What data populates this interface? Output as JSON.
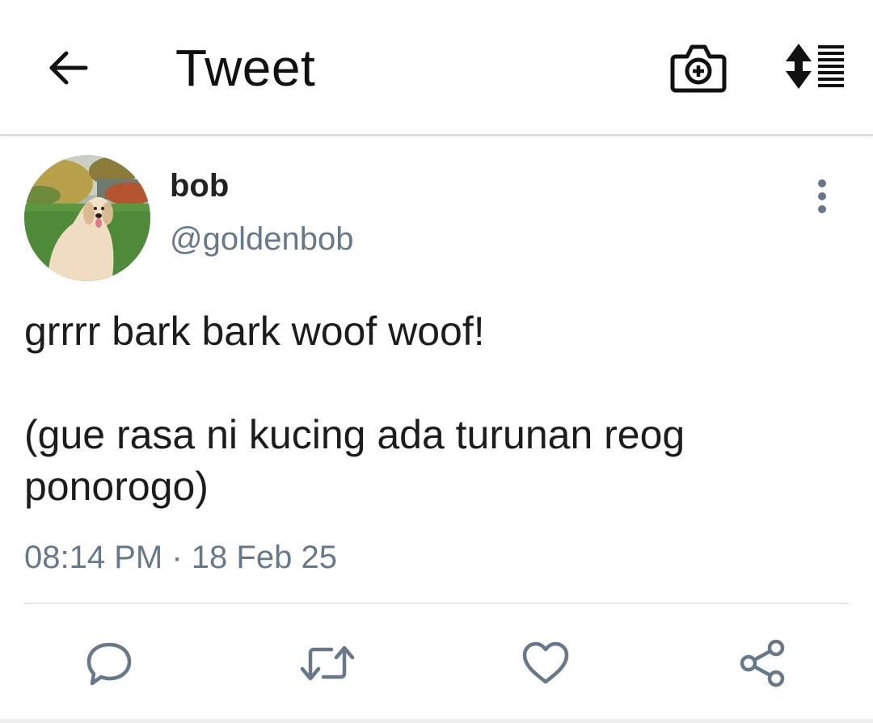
{
  "header": {
    "title": "Tweet",
    "back_icon": "arrow-left-icon",
    "camera_icon": "camera-add-icon",
    "sort_icon": "sort-list-icon"
  },
  "tweet": {
    "author": {
      "display_name": "bob",
      "handle": "@goldenbob",
      "avatar": "golden-retriever-photo"
    },
    "text_line1": "grrrr bark bark woof woof!",
    "text_line2": "(gue rasa ni kucing ada turunan reog",
    "text_line3": "ponorogo)",
    "time": "08:14 PM",
    "separator": "·",
    "date": "18 Feb 25"
  },
  "actions": [
    {
      "name": "reply",
      "icon": "reply-bubble-icon"
    },
    {
      "name": "retweet",
      "icon": "retweet-icon"
    },
    {
      "name": "like",
      "icon": "heart-icon"
    },
    {
      "name": "share",
      "icon": "share-icon"
    }
  ],
  "colors": {
    "text": "#1c1c1c",
    "secondary": "#67788a",
    "divider": "#e6e6e6"
  }
}
